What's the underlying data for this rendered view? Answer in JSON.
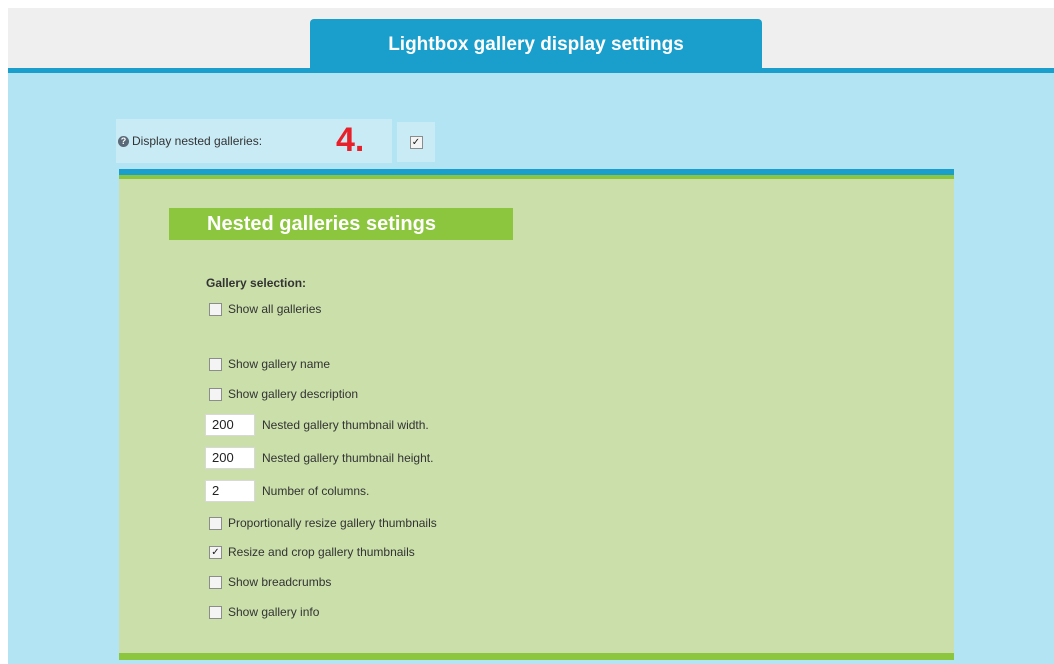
{
  "header": {
    "tab_title": "Lightbox gallery display settings"
  },
  "nested": {
    "label": "Display nested galleries:",
    "annotation": "4.",
    "checked": true,
    "help_icon": "question-circle-icon"
  },
  "section": {
    "title": "Nested galleries setings",
    "gallery_selection_label": "Gallery selection:",
    "show_all_galleries": "Show all galleries",
    "show_gallery_name": "Show gallery name",
    "show_gallery_description": "Show gallery description",
    "thumb_width_value": "200",
    "thumb_width_label": "Nested gallery thumbnail width.",
    "thumb_height_value": "200",
    "thumb_height_label": "Nested gallery thumbnail height.",
    "columns_value": "2",
    "columns_label": "Number of columns.",
    "proportional_resize": "Proportionally resize gallery thumbnails",
    "resize_crop": "Resize and crop gallery thumbnails",
    "show_breadcrumbs": "Show breadcrumbs",
    "show_gallery_info": "Show gallery info"
  },
  "checkbox_states": {
    "show_all_galleries": false,
    "show_gallery_name": false,
    "show_gallery_description": false,
    "proportional_resize": false,
    "resize_crop": true,
    "show_breadcrumbs": false,
    "show_gallery_info": false
  },
  "colors": {
    "tab_blue": "#1a9fcd",
    "panel_light_blue": "#b3e4f3",
    "green_header": "#8cc63f",
    "green_panel": "#cadfaa",
    "annotation_red": "#e8202a"
  }
}
